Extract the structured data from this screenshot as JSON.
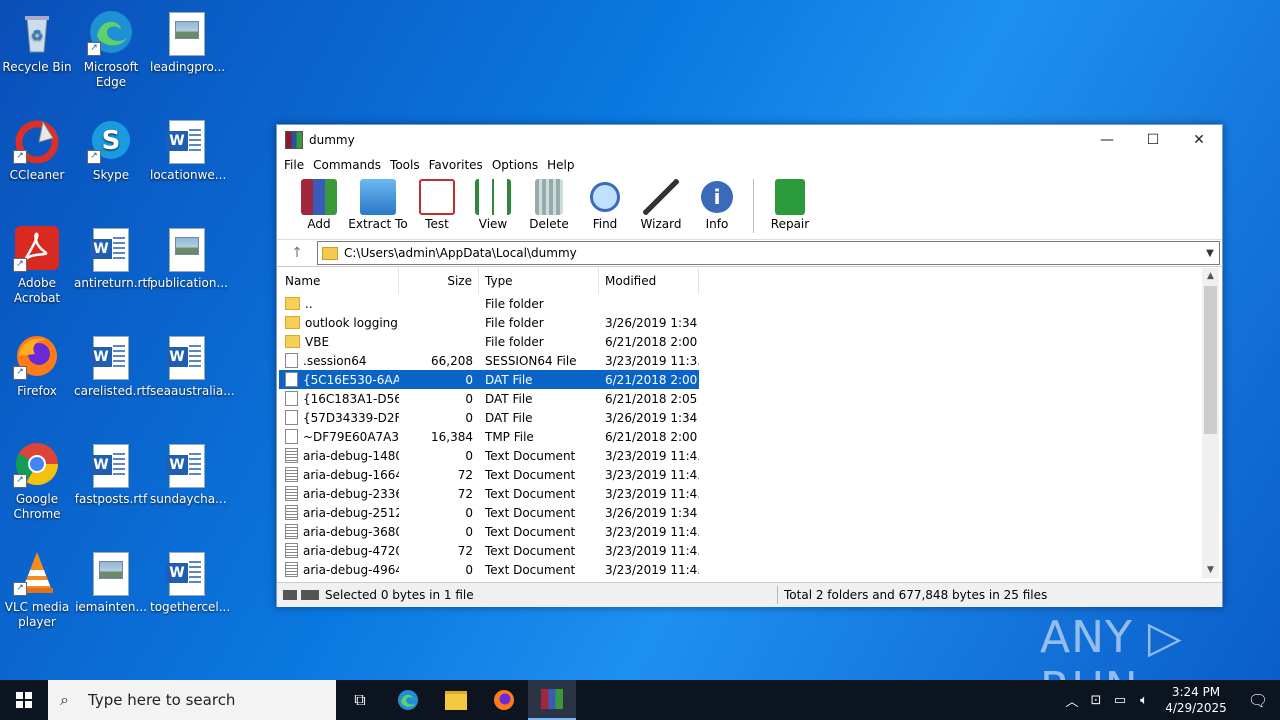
{
  "desktop": {
    "icons": [
      {
        "label": "Recycle Bin"
      },
      {
        "label": "Microsoft Edge"
      },
      {
        "label": "leadingpro..."
      },
      {
        "label": "CCleaner"
      },
      {
        "label": "Skype"
      },
      {
        "label": "locationwe..."
      },
      {
        "label": "Adobe Acrobat"
      },
      {
        "label": "antireturn.rtf"
      },
      {
        "label": "publication..."
      },
      {
        "label": "Firefox"
      },
      {
        "label": "carelisted.rtf"
      },
      {
        "label": "seaaustralia..."
      },
      {
        "label": "Google Chrome"
      },
      {
        "label": "fastposts.rtf"
      },
      {
        "label": "sundaycha..."
      },
      {
        "label": "VLC media player"
      },
      {
        "label": "iemainten..."
      },
      {
        "label": "togethercel..."
      }
    ]
  },
  "window": {
    "title": "dummy",
    "controls": {
      "minimize": "—",
      "maximize": "☐",
      "close": "✕"
    },
    "menu": [
      "File",
      "Commands",
      "Tools",
      "Favorites",
      "Options",
      "Help"
    ],
    "toolbar": [
      "Add",
      "Extract To",
      "Test",
      "View",
      "Delete",
      "Find",
      "Wizard",
      "Info",
      "Repair"
    ],
    "address": "C:\\Users\\admin\\AppData\\Local\\dummy",
    "columns": {
      "name": "Name",
      "size": "Size",
      "type": "Type",
      "modified": "Modified"
    },
    "files": [
      {
        "name": "..",
        "size": "",
        "type": "File folder",
        "modified": "",
        "kind": "folder"
      },
      {
        "name": "outlook logging",
        "size": "",
        "type": "File folder",
        "modified": "3/26/2019 1:34 ...",
        "kind": "folder"
      },
      {
        "name": "VBE",
        "size": "",
        "type": "File folder",
        "modified": "6/21/2018 2:00 ...",
        "kind": "folder"
      },
      {
        "name": ".session64",
        "size": "66,208",
        "type": "SESSION64 File",
        "modified": "3/23/2019 11:3...",
        "kind": "file"
      },
      {
        "name": "{5C16E530-6AA4...",
        "size": "0",
        "type": "DAT File",
        "modified": "6/21/2018 2:00 ...",
        "kind": "file"
      },
      {
        "name": "{16C183A1-D564...",
        "size": "0",
        "type": "DAT File",
        "modified": "6/21/2018 2:05 ...",
        "kind": "file"
      },
      {
        "name": "{57D34339-D2FF...",
        "size": "0",
        "type": "DAT File",
        "modified": "3/26/2019 1:34 ...",
        "kind": "file"
      },
      {
        "name": "~DF79E60A7A3...",
        "size": "16,384",
        "type": "TMP File",
        "modified": "6/21/2018 2:00 ...",
        "kind": "file"
      },
      {
        "name": "aria-debug-1480...",
        "size": "0",
        "type": "Text Document",
        "modified": "3/23/2019 11:4...",
        "kind": "txt"
      },
      {
        "name": "aria-debug-1664...",
        "size": "72",
        "type": "Text Document",
        "modified": "3/23/2019 11:4...",
        "kind": "txt"
      },
      {
        "name": "aria-debug-2336...",
        "size": "72",
        "type": "Text Document",
        "modified": "3/23/2019 11:4...",
        "kind": "txt"
      },
      {
        "name": "aria-debug-2512...",
        "size": "0",
        "type": "Text Document",
        "modified": "3/26/2019 1:34 ...",
        "kind": "txt"
      },
      {
        "name": "aria-debug-3680...",
        "size": "0",
        "type": "Text Document",
        "modified": "3/23/2019 11:4...",
        "kind": "txt"
      },
      {
        "name": "aria-debug-4720...",
        "size": "72",
        "type": "Text Document",
        "modified": "3/23/2019 11:4...",
        "kind": "txt"
      },
      {
        "name": "aria-debug-4964...",
        "size": "0",
        "type": "Text Document",
        "modified": "3/23/2019 11:4...",
        "kind": "txt"
      }
    ],
    "selected_row": 4,
    "status_left": "Selected 0 bytes in 1 file",
    "status_right": "Total 2 folders and 677,848 bytes in 25 files"
  },
  "watermark": "ANY ▷ RUN",
  "taskbar": {
    "search_placeholder": "Type here to search",
    "time": "3:24 PM",
    "date": "4/29/2025"
  }
}
